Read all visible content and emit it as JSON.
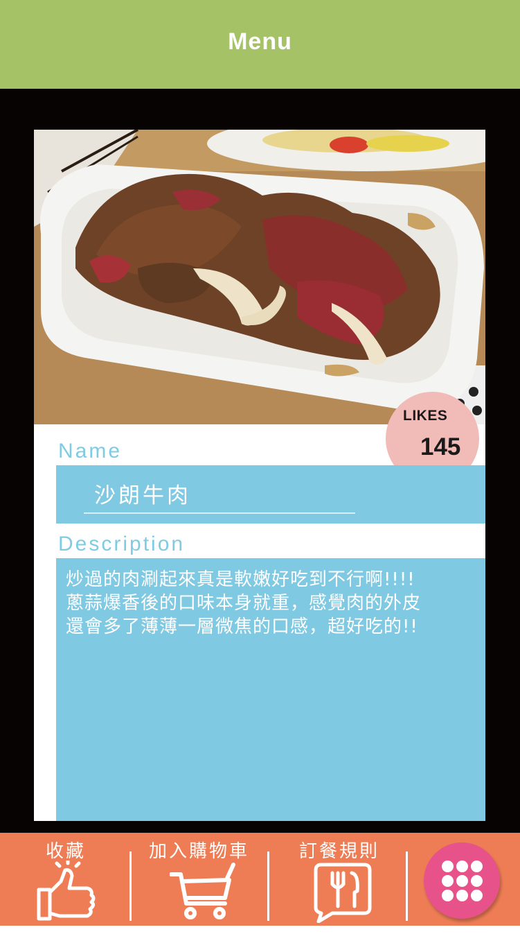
{
  "header": {
    "title": "Menu"
  },
  "photo": {
    "alt": "sirloin-beef-dish-photo"
  },
  "likes": {
    "label": "LIKES",
    "count": "145"
  },
  "name": {
    "label": "Name",
    "value": "沙朗牛肉"
  },
  "description": {
    "label": "Description",
    "text": "炒過的肉涮起來真是軟嫩好吃到不行啊!!!!\n蔥蒜爆香後的口味本身就重，感覺肉的外皮\n還會多了薄薄一層微焦的口感，超好吃的!!"
  },
  "bottom_nav": {
    "favorite": {
      "label": "收藏",
      "icon": "thumbs-up-icon"
    },
    "add_cart": {
      "label": "加入購物車",
      "icon": "shopping-cart-icon"
    },
    "rules": {
      "label": "訂餐規則",
      "icon": "utensils-icon"
    },
    "menu_grid": {
      "icon": "grid-menu-icon"
    }
  },
  "colors": {
    "header": "#a5c267",
    "accent_blue": "#7fc9e2",
    "bottom_bar": "#ee7d55",
    "likes_badge": "#f1bbb7",
    "grid_button": "#e8528a",
    "frame": "#070303"
  }
}
